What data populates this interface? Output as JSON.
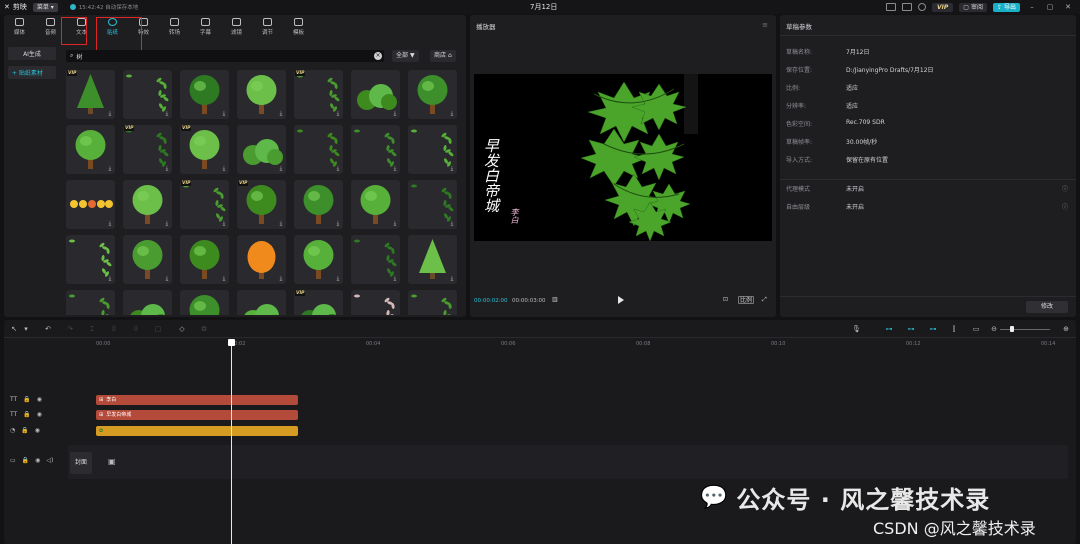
{
  "topbar": {
    "app_name": "剪映",
    "menu_label": "菜单",
    "autosave": "15:42:42 自动保存本地",
    "project_title": "7月12日",
    "vip": "VIP",
    "review": "审阅",
    "export": "导出"
  },
  "asset_tabs": [
    {
      "label": "媒体",
      "icon": "media-icon"
    },
    {
      "label": "音频",
      "icon": "audio-icon"
    },
    {
      "label": "文本",
      "icon": "text-icon"
    },
    {
      "label": "贴纸",
      "icon": "sticker-icon"
    },
    {
      "label": "特效",
      "icon": "effects-icon"
    },
    {
      "label": "转场",
      "icon": "transition-icon"
    },
    {
      "label": "字幕",
      "icon": "subtitle-icon"
    },
    {
      "label": "滤镜",
      "icon": "filter-icon"
    },
    {
      "label": "调节",
      "icon": "adjust-icon"
    },
    {
      "label": "模板",
      "icon": "template-icon"
    }
  ],
  "left_side": {
    "ai_generate": "AI生成",
    "sticker_material": "+ 贴纸素材"
  },
  "search": {
    "value": "树",
    "all_label": "全部",
    "store_label": "商店"
  },
  "sticker_grid": [
    {
      "kind": "pine",
      "vip": true
    },
    {
      "kind": "leaves",
      "vip": false
    },
    {
      "kind": "trees3",
      "vip": false
    },
    {
      "kind": "bigtree",
      "vip": false
    },
    {
      "kind": "bamboo",
      "vip": true
    },
    {
      "kind": "bushes",
      "vip": false
    },
    {
      "kind": "roundtree",
      "vip": false
    },
    {
      "kind": "tree",
      "vip": false
    },
    {
      "kind": "willow",
      "vip": true
    },
    {
      "kind": "bonsai",
      "vip": true
    },
    {
      "kind": "bushes2",
      "vip": false
    },
    {
      "kind": "willow2",
      "vip": false
    },
    {
      "kind": "bamboo2",
      "vip": false
    },
    {
      "kind": "grass",
      "vip": false
    },
    {
      "kind": "emoji",
      "vip": false
    },
    {
      "kind": "roundtree",
      "vip": false
    },
    {
      "kind": "fern",
      "vip": true
    },
    {
      "kind": "flowers",
      "vip": true
    },
    {
      "kind": "tree2",
      "vip": false
    },
    {
      "kind": "tree3",
      "vip": false
    },
    {
      "kind": "branch",
      "vip": false
    },
    {
      "kind": "leaves2",
      "vip": false
    },
    {
      "kind": "darktree",
      "vip": false
    },
    {
      "kind": "palm",
      "vip": false
    },
    {
      "kind": "autumn",
      "vip": false
    },
    {
      "kind": "tree4",
      "vip": false
    },
    {
      "kind": "dots",
      "vip": false
    },
    {
      "kind": "pine2",
      "vip": false
    },
    {
      "kind": "leaves3",
      "vip": false
    },
    {
      "kind": "bushes3",
      "vip": false
    },
    {
      "kind": "tree5",
      "vip": false
    },
    {
      "kind": "hedge",
      "vip": false
    },
    {
      "kind": "moss",
      "vip": true
    },
    {
      "kind": "twigs",
      "vip": false
    },
    {
      "kind": "dots2",
      "vip": false
    }
  ],
  "player": {
    "title": "播放器",
    "poem": "早发白帝城",
    "poet": "李白",
    "time_current": "00:00:02:00",
    "time_total": "00:00:03:00",
    "ratio_label": "比例"
  },
  "props": {
    "title": "草稿参数",
    "rows": [
      {
        "label": "草稿名称:",
        "value": "7月12日"
      },
      {
        "label": "保存位置:",
        "value": "D:/JianyingPro Drafts/7月12日"
      },
      {
        "label": "比例:",
        "value": "适应"
      },
      {
        "label": "分辨率:",
        "value": "适应"
      },
      {
        "label": "色彩空间:",
        "value": "Rec.709 SDR"
      },
      {
        "label": "草稿帧率:",
        "value": "30.00帧/秒"
      },
      {
        "label": "导入方式:",
        "value": "保留在原有位置"
      }
    ],
    "rows2": [
      {
        "label": "代理模式",
        "value": "未开启"
      },
      {
        "label": "自由层级",
        "value": "未开启"
      }
    ],
    "modify": "修改"
  },
  "timeline": {
    "ticks": [
      "00:00",
      "00:02",
      "00:04",
      "00:06",
      "00:08",
      "00:10",
      "00:12",
      "00:14"
    ],
    "tracks": [
      {
        "type": "text",
        "clip_label": "李白"
      },
      {
        "type": "text",
        "clip_label": "早发白帝城"
      },
      {
        "type": "sticker",
        "clip_label": ""
      }
    ],
    "cover": "封面"
  },
  "watermark": {
    "wechat": "公众号 · 风之馨技术录",
    "csdn": "CSDN @风之馨技术录"
  },
  "colors": {
    "accent": "#27c1d6",
    "text_clip": "#b44a3a",
    "sticker_clip": "#d59b22",
    "highlight_box": "#e02525"
  }
}
